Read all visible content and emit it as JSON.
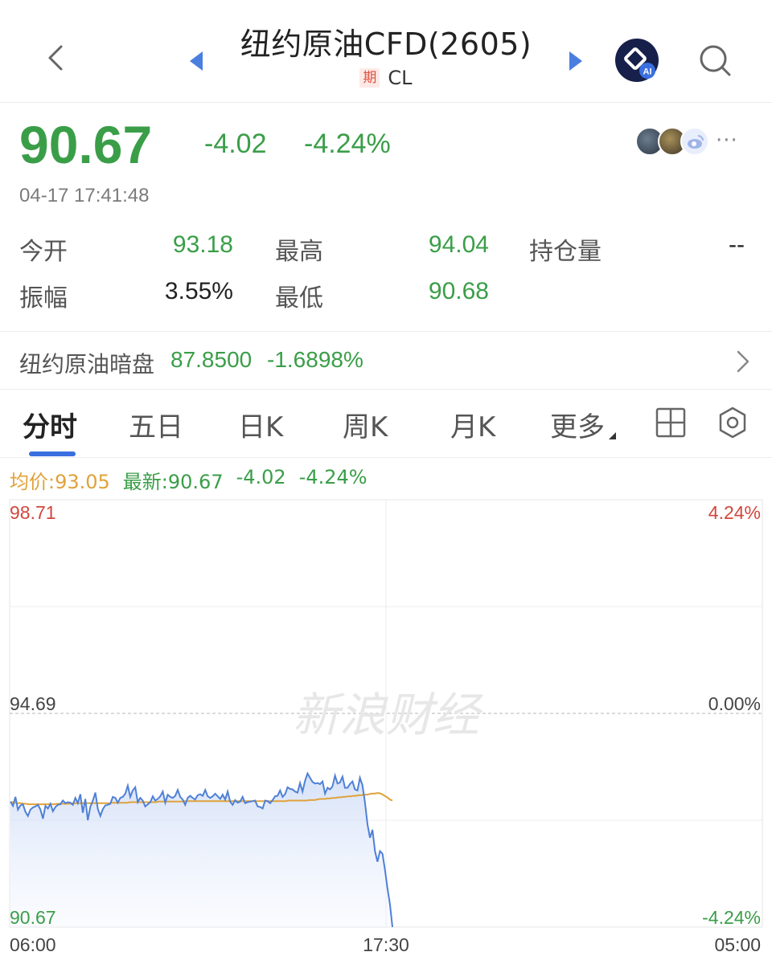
{
  "header": {
    "title": "纽约原油CFD(2605)",
    "futures_tag": "期",
    "symbol": "CL"
  },
  "quote": {
    "price": "90.67",
    "change": "-4.02",
    "change_pct": "-4.24%",
    "timestamp": "04-17 17:41:48"
  },
  "stats": {
    "open_label": "今开",
    "open_value": "93.18",
    "high_label": "最高",
    "high_value": "94.04",
    "oi_label": "持仓量",
    "oi_value": "--",
    "amplitude_label": "振幅",
    "amplitude_value": "3.55%",
    "low_label": "最低",
    "low_value": "90.68"
  },
  "dark_session": {
    "label": "纽约原油暗盘",
    "price": "87.8500",
    "change_pct": "-1.6898%"
  },
  "tabs": [
    {
      "label": "分时"
    },
    {
      "label": "五日"
    },
    {
      "label": "日K"
    },
    {
      "label": "周K"
    },
    {
      "label": "月K"
    },
    {
      "label": "更多"
    }
  ],
  "legend": {
    "avg_label": "均价:93.05",
    "latest_label": "最新:90.67",
    "change": "-4.02",
    "change_pct": "-4.24%"
  },
  "colors": {
    "down": "#3a9e48",
    "up": "#d2473c",
    "price_line": "#4f80d6",
    "avg_line": "#e0a23a",
    "accent": "#3a6fe0"
  },
  "icons": [
    "chevron-left-icon",
    "triangle-left-icon",
    "triangle-right-icon",
    "ai-icon",
    "search-icon",
    "ellipsis-icon",
    "chevron-right-icon",
    "grid-icon",
    "settings-icon"
  ],
  "chart_data": {
    "type": "line",
    "y_left_ticks": [
      "98.71",
      "94.69",
      "90.67"
    ],
    "y_right_ticks": [
      "4.24%",
      "0.00%",
      "-4.24%"
    ],
    "x_ticks": [
      "06:00",
      "17:30",
      "05:00"
    ],
    "ylim": [
      90.67,
      98.71
    ],
    "reference": 94.69,
    "watermark": "新浪财经",
    "series": [
      {
        "name": "最新",
        "values": [
          93.03,
          92.95,
          93.12,
          92.88,
          92.96,
          92.98,
          92.84,
          92.76,
          92.88,
          92.92,
          92.94,
          92.97,
          92.88,
          92.71,
          92.95,
          92.9,
          92.99,
          92.85,
          92.93,
          92.97,
          92.98,
          93.05,
          93.0,
          93.02,
          93.01,
          92.97,
          93.1,
          93.0,
          93.17,
          92.82,
          93.08,
          92.68,
          92.93,
          93.05,
          93.2,
          92.89,
          92.76,
          92.89,
          92.96,
          92.97,
          92.99,
          93.12,
          93.1,
          93.01,
          93.1,
          93.12,
          93.18,
          93.33,
          93.12,
          93.24,
          93.3,
          93.02,
          93.1,
          93.05,
          92.94,
          92.98,
          93.02,
          93.13,
          93.05,
          93.08,
          93.13,
          93.22,
          93.01,
          93.16,
          93.12,
          93.1,
          93.14,
          93.25,
          93.12,
          93.07,
          92.97,
          93.1,
          93.14,
          93.1,
          93.07,
          93.15,
          93.17,
          93.14,
          93.25,
          93.13,
          93.1,
          93.13,
          93.18,
          93.13,
          93.08,
          93.16,
          93.07,
          93.22,
          93.03,
          92.97,
          93.06,
          93.01,
          93.03,
          93.12,
          93.0,
          93.02,
          93.03,
          93.04,
          93.05,
          92.94,
          92.93,
          92.9,
          93.05,
          93.04,
          93.0,
          93.06,
          93.13,
          93.14,
          93.24,
          93.12,
          93.17,
          93.3,
          93.27,
          93.26,
          93.22,
          93.2,
          93.38,
          93.22,
          93.42,
          93.56,
          93.48,
          93.4,
          93.37,
          93.38,
          93.36,
          93.41,
          93.18,
          93.29,
          93.26,
          93.32,
          93.52,
          93.37,
          93.39,
          93.5,
          93.29,
          93.29,
          93.36,
          93.41,
          93.26,
          93.24,
          93.48,
          93.34,
          93.02,
          92.6,
          92.35,
          92.5,
          92.1,
          91.9,
          92.1,
          92.05,
          91.75,
          91.4,
          91.1,
          90.67
        ]
      },
      {
        "name": "均价",
        "values": [
          93.02,
          93.02,
          93.01,
          93.0,
          93.0,
          92.99,
          92.99,
          92.98,
          92.98,
          92.98,
          92.98,
          92.98,
          92.98,
          92.98,
          92.98,
          92.98,
          92.98,
          92.98,
          92.99,
          92.99,
          92.99,
          92.99,
          92.99,
          92.99,
          93.0,
          93.0,
          93.0,
          93.0,
          93.0,
          93.0,
          93.0,
          93.0,
          93.0,
          93.0,
          93.0,
          93.0,
          93.0,
          93.0,
          93.0,
          93.01,
          93.01,
          93.01,
          93.01,
          93.01,
          93.01,
          93.01,
          93.02,
          93.02,
          93.02,
          93.02,
          93.02,
          93.02,
          93.02,
          93.02,
          93.02,
          93.02,
          93.02,
          93.03,
          93.03,
          93.03,
          93.03,
          93.03,
          93.03,
          93.03,
          93.03,
          93.03,
          93.03,
          93.04,
          93.04,
          93.04,
          93.04,
          93.04,
          93.04,
          93.04,
          93.04,
          93.04,
          93.04,
          93.04,
          93.04,
          93.04,
          93.04,
          93.04,
          93.04,
          93.04,
          93.04,
          93.04,
          93.04,
          93.04,
          93.04,
          93.04,
          93.04,
          93.04,
          93.04,
          93.04,
          93.04,
          93.04,
          93.04,
          93.04,
          93.04,
          93.04,
          93.04,
          93.04,
          93.04,
          93.04,
          93.04,
          93.04,
          93.04,
          93.05,
          93.05,
          93.05,
          93.05,
          93.05,
          93.05,
          93.05,
          93.05,
          93.06,
          93.06,
          93.06,
          93.07,
          93.08,
          93.08,
          93.08,
          93.09,
          93.09,
          93.1,
          93.1,
          93.11,
          93.11,
          93.12,
          93.12,
          93.13,
          93.13,
          93.14,
          93.14,
          93.15,
          93.15,
          93.16,
          93.16,
          93.17,
          93.18,
          93.18,
          93.19,
          93.19,
          93.17,
          93.14,
          93.11,
          93.07,
          93.05
        ]
      }
    ]
  }
}
